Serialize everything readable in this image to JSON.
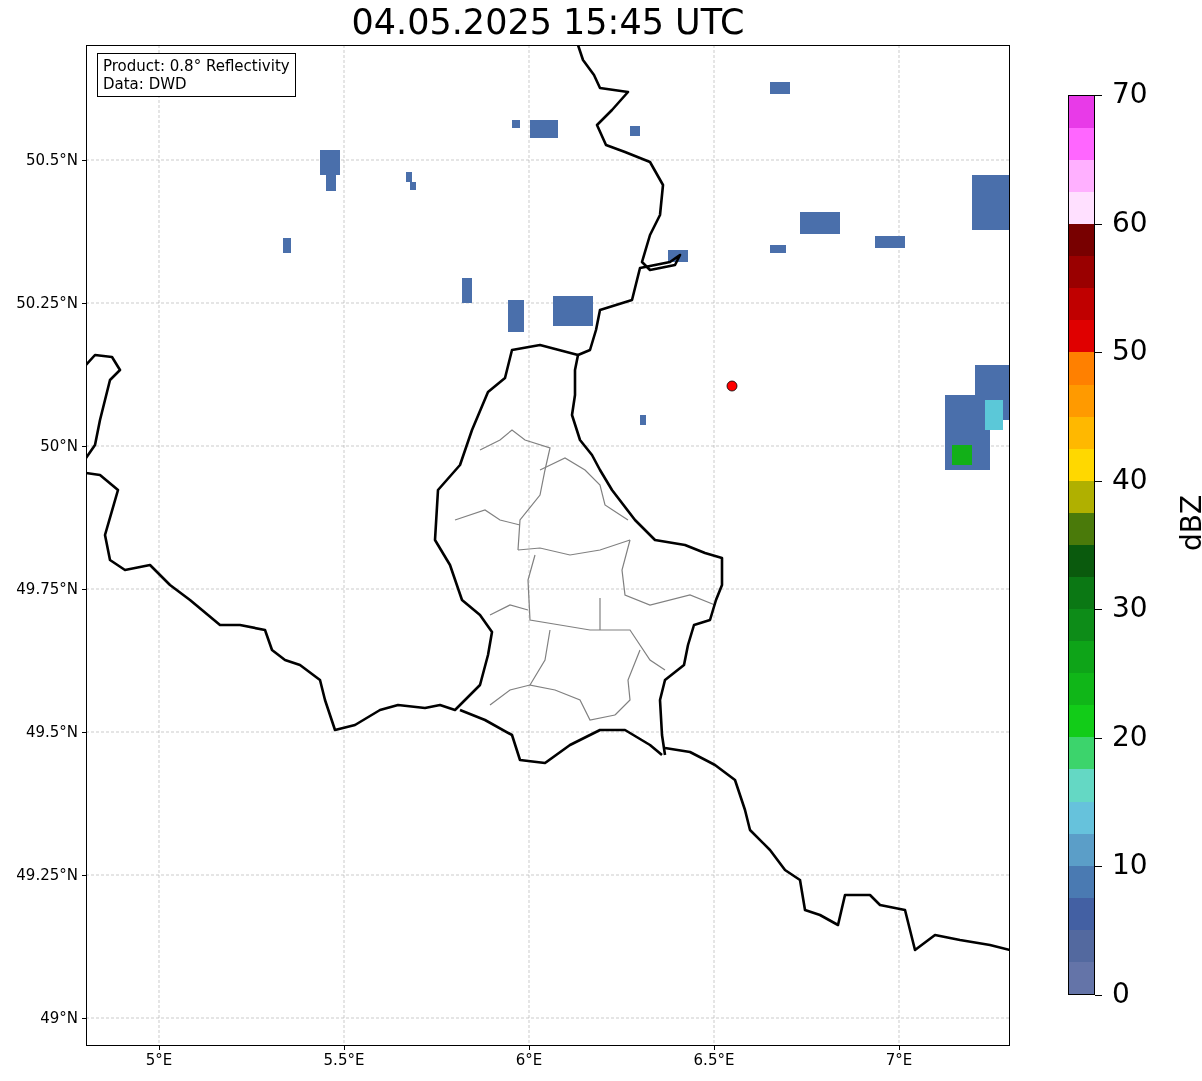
{
  "title": "04.05.2025 15:45 UTC",
  "info_box": {
    "lines": [
      "Product: 0.8° Reflectivity",
      "Data: DWD"
    ]
  },
  "map": {
    "lat_ticks": [
      "50.5°N",
      "50.25°N",
      "50°N",
      "49.75°N",
      "49.5°N",
      "49.25°N",
      "49°N"
    ],
    "lon_ticks": [
      "5°E",
      "5.5°E",
      "6°E",
      "6.5°E",
      "7°E"
    ]
  },
  "colorbar": {
    "label": "dBZ",
    "ticks": [
      "70",
      "60",
      "50",
      "40",
      "30",
      "20",
      "10",
      "0"
    ],
    "bands": [
      {
        "color": "#6474a8"
      },
      {
        "color": "#53699f"
      },
      {
        "color": "#4360a3"
      },
      {
        "color": "#4a7ab2"
      },
      {
        "color": "#5b9ec8"
      },
      {
        "color": "#66c2dc"
      },
      {
        "color": "#64d8c4"
      },
      {
        "color": "#3cd46c"
      },
      {
        "color": "#12cc18"
      },
      {
        "color": "#10b618"
      },
      {
        "color": "#0ea418"
      },
      {
        "color": "#0d8c18"
      },
      {
        "color": "#0b7814"
      },
      {
        "color": "#0a5a0d"
      },
      {
        "color": "#4a7a0a"
      },
      {
        "color": "#b0b000"
      },
      {
        "color": "#ffd800"
      },
      {
        "color": "#ffb800"
      },
      {
        "color": "#ff9a00"
      },
      {
        "color": "#ff8000"
      },
      {
        "color": "#e00000"
      },
      {
        "color": "#c00000"
      },
      {
        "color": "#9a0000"
      },
      {
        "color": "#780000"
      },
      {
        "color": "#ffe0ff"
      },
      {
        "color": "#ffb0ff"
      },
      {
        "color": "#ff66ff"
      },
      {
        "color": "#e83ae8"
      }
    ]
  }
}
